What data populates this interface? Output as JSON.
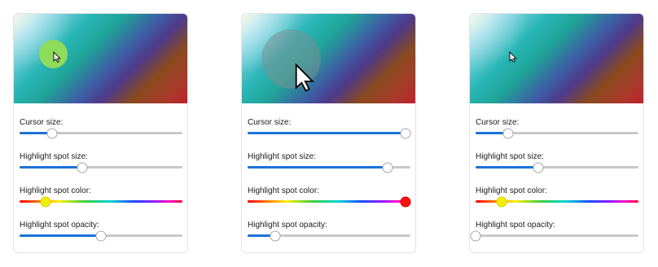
{
  "labels": {
    "cursor_size": "Cursor size:",
    "spot_size": "Highlight spot size:",
    "spot_color": "Highlight spot color:",
    "spot_opacity": "Highlight spot opacity:"
  },
  "panels": [
    {
      "cursor_size": 0.2,
      "spot_size": 0.39,
      "spot_color": 0.16,
      "spot_color_hex": "#f2ee00",
      "spot_opacity": 0.5,
      "preview_spot_color": "#8fdc5a"
    },
    {
      "cursor_size": 0.97,
      "spot_size": 0.86,
      "spot_color": 0.97,
      "spot_color_hex": "#ff1010",
      "spot_opacity": 0.16,
      "preview_spot_color": "#7a8f96"
    },
    {
      "cursor_size": 0.2,
      "spot_size": 0.39,
      "spot_color": 0.16,
      "spot_color_hex": "#f2ee00",
      "spot_opacity": 0.0,
      "preview_spot_color": "#00000000"
    }
  ],
  "icons": {
    "cursor": "arrow-cursor-icon"
  }
}
